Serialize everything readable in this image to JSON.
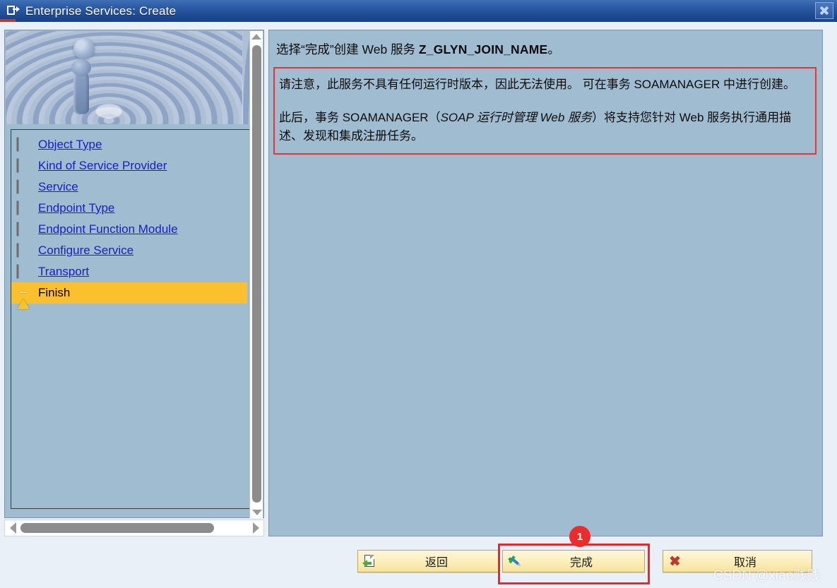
{
  "window": {
    "title": "Enterprise Services: Create",
    "title_icon": "export-window-icon",
    "close_icon": "close-icon"
  },
  "sidebar": {
    "hero_image": "water-droplet-splash-image",
    "steps": [
      {
        "label": "Object Type",
        "icon": "green-led-icon",
        "state": "done"
      },
      {
        "label": "Kind of Service Provider",
        "icon": "green-led-icon",
        "state": "done"
      },
      {
        "label": "Service",
        "icon": "green-led-icon",
        "state": "done"
      },
      {
        "label": "Endpoint Type",
        "icon": "green-led-icon",
        "state": "done"
      },
      {
        "label": "Endpoint Function Module",
        "icon": "green-led-icon",
        "state": "done"
      },
      {
        "label": "Configure Service",
        "icon": "green-led-icon",
        "state": "done"
      },
      {
        "label": "Transport",
        "icon": "green-led-icon",
        "state": "done"
      },
      {
        "label": "Finish",
        "icon": "warning-triangle-icon",
        "state": "active"
      }
    ],
    "vscroll": {
      "up_icon": "scroll-up-arrow-icon",
      "down_icon": "scroll-down-arrow-icon"
    },
    "hscroll": {
      "left_icon": "scroll-left-arrow-icon",
      "right_icon": "scroll-right-arrow-icon"
    }
  },
  "main": {
    "heading_prefix": "选择“完成”创建 Web 服务 ",
    "service_name": "Z_GLYN_JOIN_NAME",
    "heading_suffix": "。",
    "notice": {
      "paragraph1": "请注意，此服务不具有任何运行时版本，因此无法使用。 可在事务 SOAMANAGER 中进行创建。",
      "paragraph2_part1": "此后，事务 SOAMANAGER（",
      "paragraph2_italic": "SOAP 运行时管理 Web 服务",
      "paragraph2_part2": "）将支持您针对 Web 服务执行通用描述、发现和集成注册任务。",
      "border_color": "#f03232"
    }
  },
  "footer": {
    "back_label": "返回",
    "back_icon": "page-back-arrow-icon",
    "finish_label": "完成",
    "finish_icon": "green-check-pen-icon",
    "cancel_label": "取消",
    "cancel_icon": "red-x-icon"
  },
  "annotation": {
    "badge_number": "1",
    "highlight_color": "#f0252a",
    "target": "finish-button"
  },
  "watermark": {
    "text": "CSDN @xiao贱贱"
  }
}
